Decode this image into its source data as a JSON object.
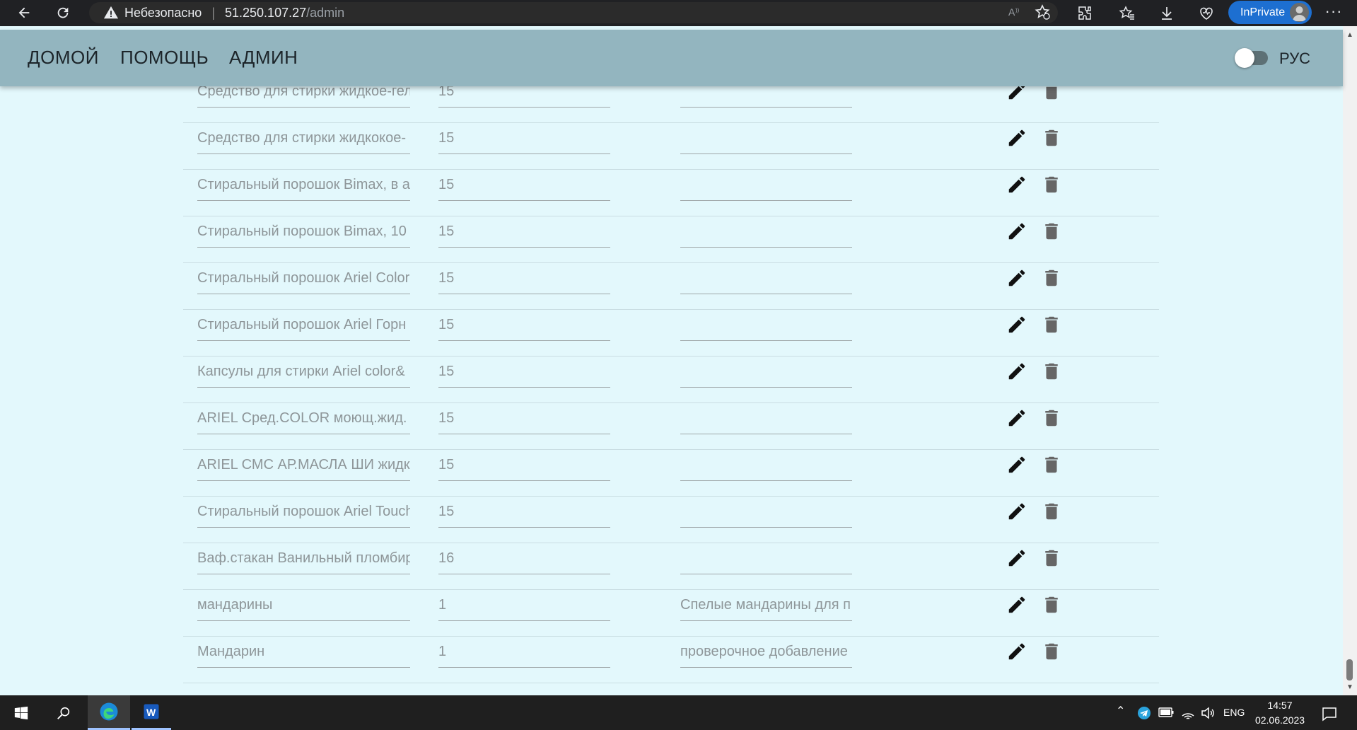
{
  "browser": {
    "insecure_label": "Небезопасно",
    "url_host": "51.250.107.27",
    "url_path": "/admin",
    "inprivate_label": "InPrivate",
    "more_label": "···"
  },
  "header": {
    "nav": [
      "ДОМОЙ",
      "ПОМОЩЬ",
      "АДМИН"
    ],
    "lang_label": "РУС"
  },
  "rows": [
    {
      "name": "Средство для стирки жидкое-гель",
      "qty": "15",
      "desc": ""
    },
    {
      "name": "Средство для стирки жидкокое-",
      "qty": "15",
      "desc": ""
    },
    {
      "name": "Стиральный порошок Bimax, в а",
      "qty": "15",
      "desc": ""
    },
    {
      "name": "Стиральный порошок Bimax, 10",
      "qty": "15",
      "desc": ""
    },
    {
      "name": "Стиральный порошок Ariel Color",
      "qty": "15",
      "desc": ""
    },
    {
      "name": "Стиральный порошок Ariel Горн",
      "qty": "15",
      "desc": ""
    },
    {
      "name": "Капсулы для стирки Ariel color&",
      "qty": "15",
      "desc": ""
    },
    {
      "name": "ARIEL Сред.COLOR моющ.жид.",
      "qty": "15",
      "desc": ""
    },
    {
      "name": "ARIEL СМС АР.МАСЛА ШИ жидк",
      "qty": "15",
      "desc": ""
    },
    {
      "name": "Стиральный порошок Ariel Touch",
      "qty": "15",
      "desc": ""
    },
    {
      "name": "Ваф.стакан Ванильный пломбир",
      "qty": "16",
      "desc": ""
    },
    {
      "name": "мандарины",
      "qty": "1",
      "desc": "Спелые мандарины для п"
    },
    {
      "name": "Мандарин",
      "qty": "1",
      "desc": "проверочное добавление"
    }
  ],
  "taskbar": {
    "lang": "ENG",
    "time": "14:57",
    "date": "02.06.2023"
  }
}
